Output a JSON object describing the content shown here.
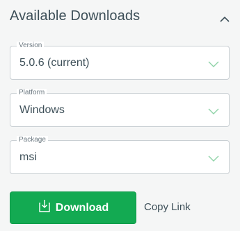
{
  "section": {
    "title": "Available Downloads",
    "collapse_icon": "chevron-up-icon"
  },
  "fields": [
    {
      "legend": "Version",
      "value": "5.0.6 (current)",
      "icon": "chevron-down-icon"
    },
    {
      "legend": "Platform",
      "value": "Windows",
      "icon": "chevron-down-icon"
    },
    {
      "legend": "Package",
      "value": "msi",
      "icon": "chevron-down-icon"
    }
  ],
  "actions": {
    "download_label": "Download",
    "download_icon": "download-icon",
    "copy_link_label": "Copy Link"
  },
  "colors": {
    "accent": "#13aa52",
    "chevron": "#8fd3a8",
    "text": "#3d4f58"
  }
}
